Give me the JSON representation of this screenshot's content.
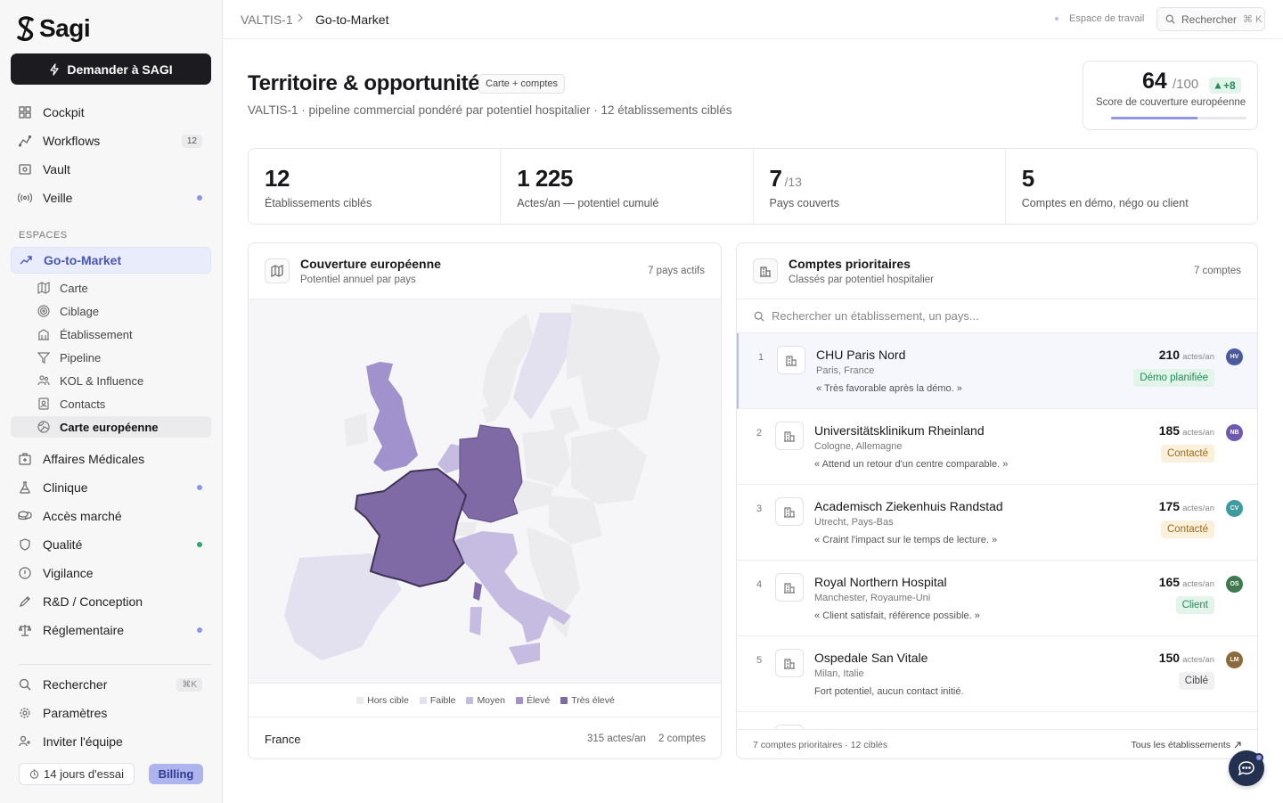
{
  "brand": {
    "name": "Sagi"
  },
  "sidebar": {
    "ask_button": "Demander à SAGI",
    "main": [
      {
        "label": "Cockpit",
        "icon": "grid-icon"
      },
      {
        "label": "Workflows",
        "icon": "workflow-icon",
        "badge": "12"
      },
      {
        "label": "Vault",
        "icon": "vault-icon"
      },
      {
        "label": "Veille",
        "icon": "radar-icon"
      }
    ],
    "section_label": "ESPACES",
    "active_space": "Go-to-Market",
    "sub_items": [
      {
        "label": "Carte",
        "icon": "map-icon"
      },
      {
        "label": "Ciblage",
        "icon": "target-icon"
      },
      {
        "label": "Établissement",
        "icon": "building-icon"
      },
      {
        "label": "Pipeline",
        "icon": "filter-icon"
      },
      {
        "label": "KOL & Influence",
        "icon": "people-icon"
      },
      {
        "label": "Contacts",
        "icon": "contact-icon"
      },
      {
        "label": "Carte européenne",
        "icon": "globe-icon"
      }
    ],
    "spaces": [
      {
        "label": "Affaires Médicales",
        "icon": "medical-case-icon"
      },
      {
        "label": "Clinique",
        "icon": "flask-icon"
      },
      {
        "label": "Accès marché",
        "icon": "coins-icon"
      },
      {
        "label": "Qualité",
        "icon": "shield-icon"
      },
      {
        "label": "Vigilance",
        "icon": "alert-icon"
      },
      {
        "label": "R&D / Conception",
        "icon": "pen-icon"
      },
      {
        "label": "Réglementaire",
        "icon": "scale-icon"
      }
    ],
    "bottom": [
      {
        "label": "Rechercher",
        "icon": "search-icon",
        "kbd": "⌘K"
      },
      {
        "label": "Paramètres",
        "icon": "gear-icon"
      },
      {
        "label": "Inviter l'équipe",
        "icon": "user-plus-icon"
      }
    ],
    "trial": "14 jours d'essai",
    "billing": "Billing"
  },
  "topbar": {
    "crumb_root": "VALTIS-1",
    "crumb_current": "Go-to-Market",
    "workspace": "Espace de travail",
    "search_label": "Rechercher",
    "search_kbd": "⌘ K"
  },
  "page": {
    "title": "Territoire & opportunités",
    "tag": "Carte + comptes",
    "subtitle": "VALTIS-1 · pipeline commercial pondéré par potentiel hospitalier · 12 établissements ciblés"
  },
  "score": {
    "value": "64",
    "of": "/100",
    "delta": "+8",
    "label": "Score de couverture européenne",
    "progress": 0.64
  },
  "stats": [
    {
      "value": "12",
      "suffix": "",
      "label": "Établissements ciblés"
    },
    {
      "value": "1 225",
      "suffix": "",
      "label": "Actes/an — potentiel cumulé"
    },
    {
      "value": "7",
      "suffix": "/13",
      "label": "Pays couverts"
    },
    {
      "value": "5",
      "suffix": "",
      "label": "Comptes en démo, négo ou client"
    }
  ],
  "map_card": {
    "title": "Couverture européenne",
    "subtitle": "Potentiel annuel par pays",
    "right": "7 pays actifs",
    "legend": [
      {
        "label": "Hors cible",
        "color": "#ececef"
      },
      {
        "label": "Faible",
        "color": "#e3e0f0"
      },
      {
        "label": "Moyen",
        "color": "#c6bce2"
      },
      {
        "label": "Élevé",
        "color": "#a191cc"
      },
      {
        "label": "Très élevé",
        "color": "#7f6aa6"
      }
    ],
    "footer": {
      "country": "France",
      "acts": "315 actes/an",
      "accounts": "2 comptes"
    }
  },
  "accounts_card": {
    "title": "Comptes prioritaires",
    "subtitle": "Classés par potentiel hospitalier",
    "right": "7 comptes",
    "search_placeholder": "Rechercher un établissement, un pays...",
    "unit": "actes/an",
    "rows": [
      {
        "rank": "1",
        "name": "CHU Paris Nord",
        "location": "Paris, France",
        "quote": "« Très favorable après la démo. »",
        "acts": "210",
        "status": "Démo planifiée",
        "status_bg": "#e3f4ea",
        "status_fg": "#238c57",
        "initials": "HV",
        "avatar_color": "#4a5a9c"
      },
      {
        "rank": "2",
        "name": "Universitätsklinikum Rheinland",
        "location": "Cologne, Allemagne",
        "quote": "« Attend un retour d'un centre comparable. »",
        "acts": "185",
        "status": "Contacté",
        "status_bg": "#fbf0dc",
        "status_fg": "#a56a13",
        "initials": "NB",
        "avatar_color": "#6e58b0"
      },
      {
        "rank": "3",
        "name": "Academisch Ziekenhuis Randstad",
        "location": "Utrecht, Pays-Bas",
        "quote": "« Craint l'impact sur le temps de lecture. »",
        "acts": "175",
        "status": "Contacté",
        "status_bg": "#fbf0dc",
        "status_fg": "#a56a13",
        "initials": "CV",
        "avatar_color": "#3d9ba0"
      },
      {
        "rank": "4",
        "name": "Royal Northern Hospital",
        "location": "Manchester, Royaume-Uni",
        "quote": "« Client satisfait, référence possible. »",
        "acts": "165",
        "status": "Client",
        "status_bg": "#e3f4ea",
        "status_fg": "#238c57",
        "initials": "OS",
        "avatar_color": "#3f7a4e"
      },
      {
        "rank": "5",
        "name": "Ospedale San Vitale",
        "location": "Milan, Italie",
        "quote": "Fort potentiel, aucun contact initié.",
        "acts": "150",
        "status": "Ciblé",
        "status_bg": "#f1f1f3",
        "status_fg": "#444",
        "initials": "LM",
        "avatar_color": "#8a6b3d"
      }
    ],
    "footer_left": "7 comptes prioritaires · 12 ciblés",
    "footer_right": "Tous les établissements"
  }
}
